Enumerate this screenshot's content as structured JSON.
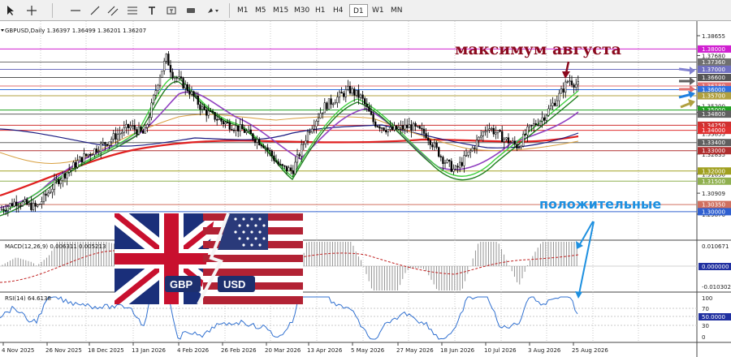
{
  "toolbar": {
    "timeframes": [
      "M1",
      "M5",
      "M15",
      "M30",
      "H1",
      "H4",
      "D1",
      "W1",
      "MN"
    ],
    "active_timeframe": "D1",
    "icons": [
      "crosshair-icon",
      "cursor-icon",
      "horizontal-line-icon",
      "trendline-icon",
      "channel-icon",
      "fibonacci-icon",
      "text-icon",
      "label-icon",
      "rectangle-icon",
      "arrow-shapes-icon"
    ]
  },
  "chart": {
    "header": "GBPUSD,Daily  1.36397 1.36499 1.36201 1.36207",
    "x_labels": [
      "4 Nov 2025",
      "26 Nov 2025",
      "18 Dec 2025",
      "13 Jan 2026",
      "4 Feb 2026",
      "26 Feb 2026",
      "20 Mar 2026",
      "13 Apr 2026",
      "5 May 2026",
      "27 May 2026",
      "18 Jun 2026",
      "10 Jul 2026",
      "3 Aug 2026",
      "25 Aug 2026"
    ],
    "price_ticks": [
      "1.38655",
      "1.37680",
      "1.36200",
      "1.35200",
      "1.34880",
      "1.33853",
      "1.32835",
      "1.31850",
      "1.30909",
      "1.29876"
    ],
    "levels": [
      {
        "label": "1.38000",
        "color": "#d020d0"
      },
      {
        "label": "1.37360",
        "color": "#707070"
      },
      {
        "label": "1.37000",
        "color": "#7070c0"
      },
      {
        "label": "1.36600",
        "color": "#555555"
      },
      {
        "label": "1.36180",
        "color": "#e07070"
      },
      {
        "label": "1.36000",
        "color": "#3070e0"
      },
      {
        "label": "1.35700",
        "color": "#b0a040"
      },
      {
        "label": "1.35000",
        "color": "#20a020"
      },
      {
        "label": "1.34800",
        "color": "#606060"
      },
      {
        "label": "1.34250",
        "color": "#d03030"
      },
      {
        "label": "1.34000",
        "color": "#e03030"
      },
      {
        "label": "1.33400",
        "color": "#606060"
      },
      {
        "label": "1.33000",
        "color": "#b03030"
      },
      {
        "label": "1.32000",
        "color": "#a0a020"
      },
      {
        "label": "1.31500",
        "color": "#90b050"
      },
      {
        "label": "1.30350",
        "color": "#d07060"
      },
      {
        "label": "1.30000",
        "color": "#3060d0"
      }
    ],
    "macd": {
      "label": "MACD(12,26,9) 0.006311 0.005213",
      "ticks": [
        "0.010671",
        "0.000000",
        "-0.010302"
      ]
    },
    "rsi": {
      "label": "RSI(14) 64.6138",
      "ticks": [
        "100",
        "70",
        "50.0000",
        "30",
        "0"
      ]
    },
    "annotations": {
      "top": "максимум августа",
      "mid": "положительные"
    },
    "flag": {
      "left": "GBP",
      "right": "USD"
    }
  }
}
